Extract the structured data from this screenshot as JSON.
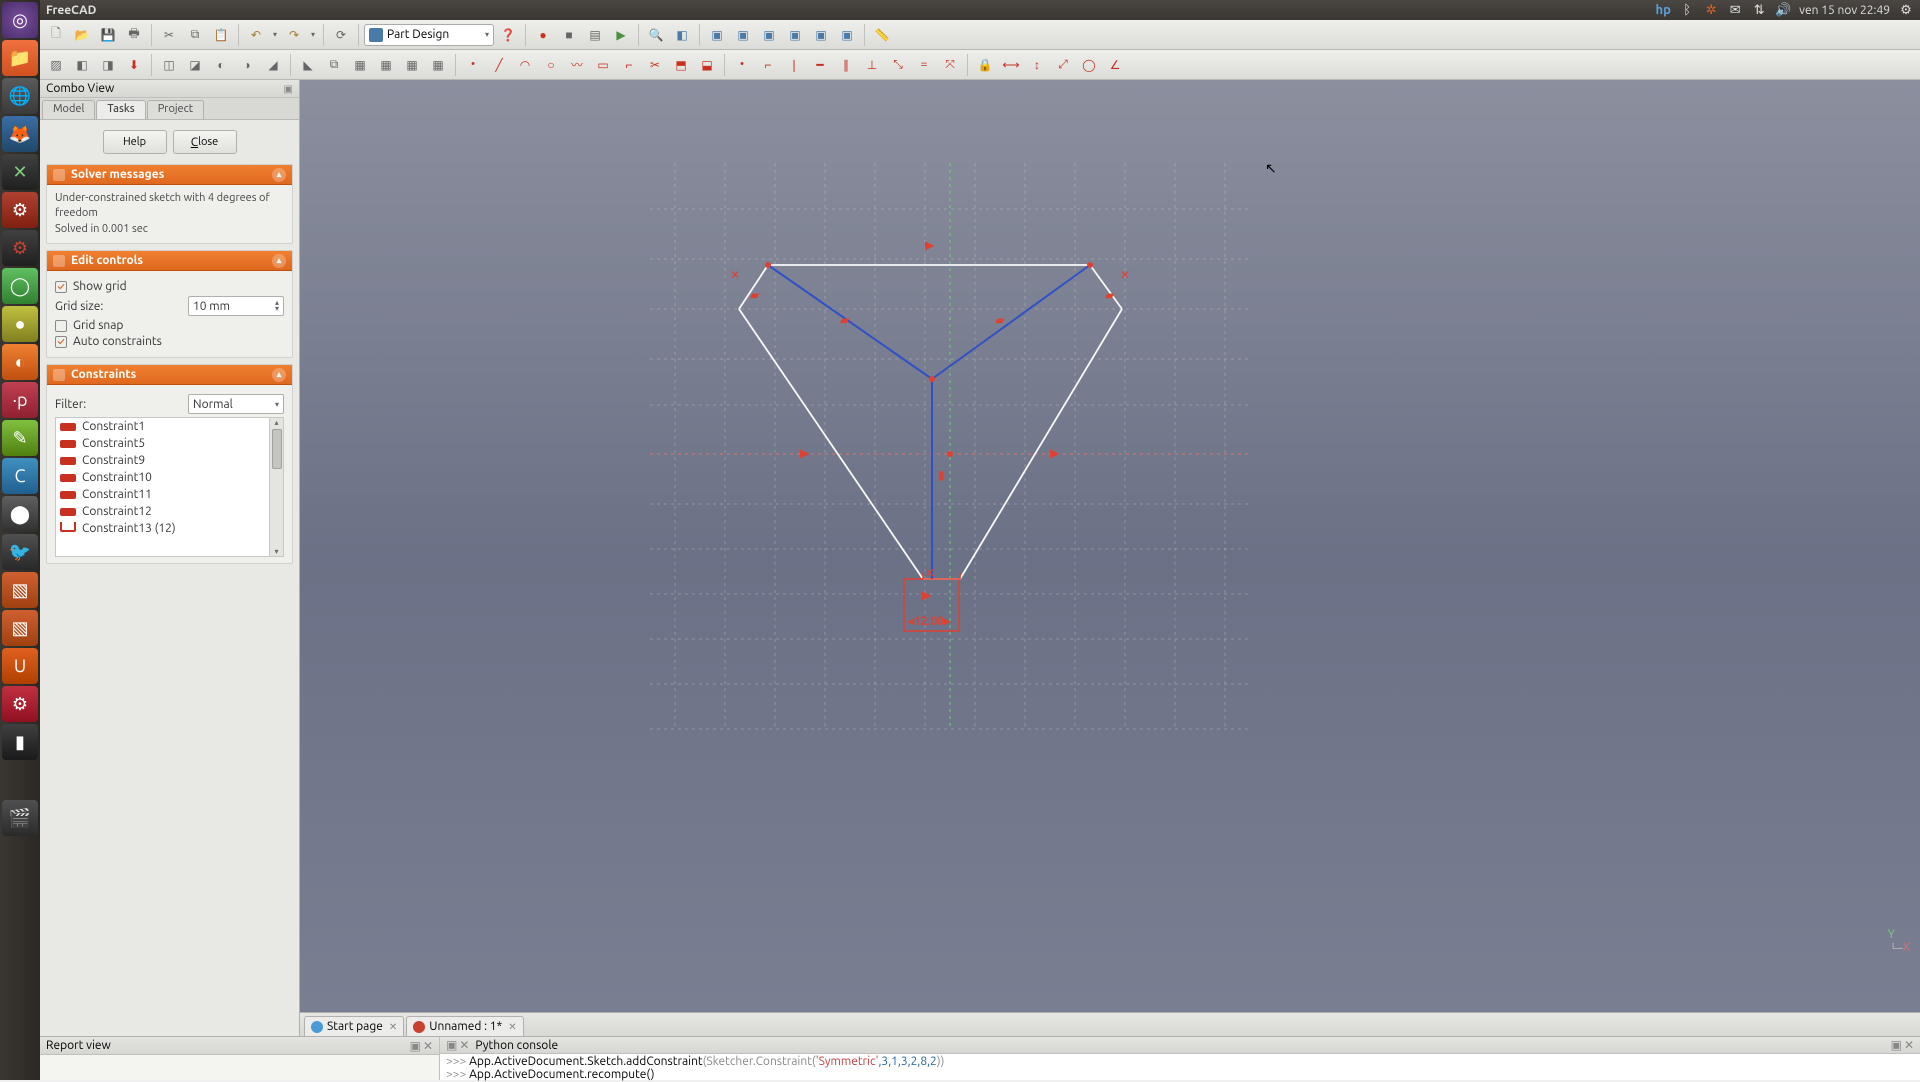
{
  "app": {
    "title": "FreeCAD"
  },
  "indicators": {
    "clock": "ven 15 nov 22:49"
  },
  "workbench": {
    "name": "Part Design"
  },
  "combo": {
    "title": "Combo View",
    "tabs": {
      "model": "Model",
      "tasks": "Tasks",
      "project": "Project"
    },
    "help": "Help",
    "close": "Close"
  },
  "solver": {
    "title": "Solver messages",
    "line1": "Under-constrained sketch with 4 degrees of freedom",
    "line2": "Solved in 0.001 sec"
  },
  "edit": {
    "title": "Edit controls",
    "show_grid": "Show grid",
    "grid_size_label": "Grid size:",
    "grid_size_value": "10 mm",
    "grid_snap": "Grid snap",
    "auto_constraints": "Auto constraints"
  },
  "constraints": {
    "title": "Constraints",
    "filter_label": "Filter:",
    "filter_value": "Normal",
    "items": [
      {
        "icon": "hor",
        "label": "Constraint1"
      },
      {
        "icon": "hor",
        "label": "Constraint5"
      },
      {
        "icon": "hor",
        "label": "Constraint9"
      },
      {
        "icon": "hor",
        "label": "Constraint10"
      },
      {
        "icon": "hor",
        "label": "Constraint11"
      },
      {
        "icon": "hor",
        "label": "Constraint12"
      },
      {
        "icon": "dim",
        "label": "Constraint13 (12)"
      }
    ]
  },
  "doc_tabs": {
    "start": "Start page",
    "unnamed": "Unnamed : 1*"
  },
  "report": {
    "title": "Report view"
  },
  "pyconsole": {
    "title": "Python console",
    "line1_fn": "App.ActiveDocument.Sketch.addConstraint",
    "line1_args_pre": "(Sketcher.Constraint(",
    "line1_str": "'Symmetric'",
    "line1_nums": ",3,1,3,2,8,2",
    "line1_post": "))",
    "line2": "App.ActiveDocument.recompute()"
  },
  "sketch": {
    "dim_label": "12.00"
  }
}
